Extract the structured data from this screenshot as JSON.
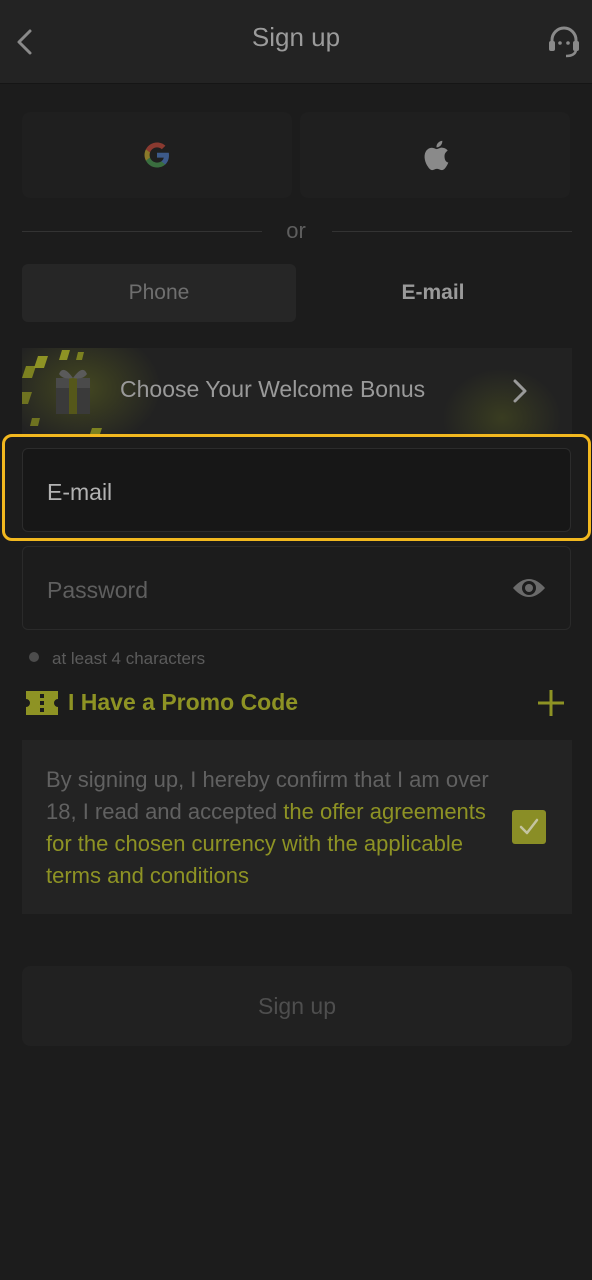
{
  "header": {
    "title": "Sign up",
    "back_icon": "chevron-left-icon",
    "support_icon": "headset-support-icon"
  },
  "social": {
    "google_icon": "google-icon",
    "apple_icon": "apple-icon",
    "or_label": "or"
  },
  "tabs": [
    {
      "label": "Phone",
      "active": false
    },
    {
      "label": "E-mail",
      "active": true
    }
  ],
  "bonus": {
    "label": "Choose Your Welcome Bonus",
    "icon": "gift-box-icon",
    "arrow_icon": "chevron-right-icon"
  },
  "form": {
    "email_placeholder": "E-mail",
    "password_placeholder": "Password",
    "password_eye_icon": "eye-icon",
    "password_hint": "at least 4 characters"
  },
  "promo": {
    "label": "I Have a Promo Code",
    "icon": "ticket-icon",
    "plus_icon": "plus-icon"
  },
  "terms": {
    "text_plain": "By signing up, I hereby confirm that I am over 18, I read and accepted ",
    "text_link": "the offer agreements for the chosen currency with the applicable terms and conditions",
    "checked": true
  },
  "submit": {
    "label": "Sign up"
  },
  "colors": {
    "accent": "#8e9324",
    "highlight": "#f2b81f",
    "background": "#1c1c1c"
  }
}
